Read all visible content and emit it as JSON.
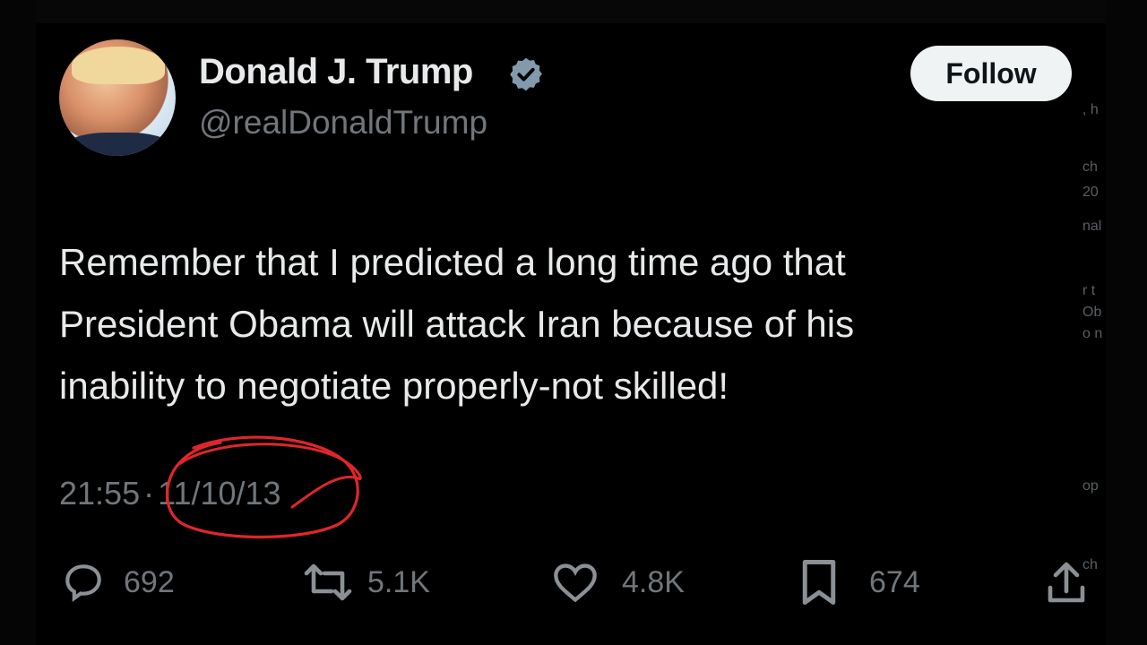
{
  "author": {
    "name": "Donald J. Trump",
    "handle": "@realDonaldTrump",
    "verified": true
  },
  "follow_label": "Follow",
  "tweet": {
    "lines": [
      "Remember that I predicted a long time ago that",
      "President Obama will attack Iran because of his",
      "inability to negotiate properly-not skilled!"
    ],
    "time": "21:55",
    "separator": "·",
    "date": "11/10/13"
  },
  "stats": {
    "replies": "692",
    "reposts": "5.1K",
    "likes": "4.8K",
    "bookmarks": "674"
  },
  "annotation_color": "#e0262b",
  "side_fragments": [
    ", h",
    "ch",
    "20",
    "nal",
    "r t",
    "Ob",
    "o n",
    "op",
    "ch"
  ],
  "icons": [
    "verified-badge-icon",
    "reply-icon",
    "repost-icon",
    "like-icon",
    "bookmark-icon",
    "share-icon"
  ]
}
